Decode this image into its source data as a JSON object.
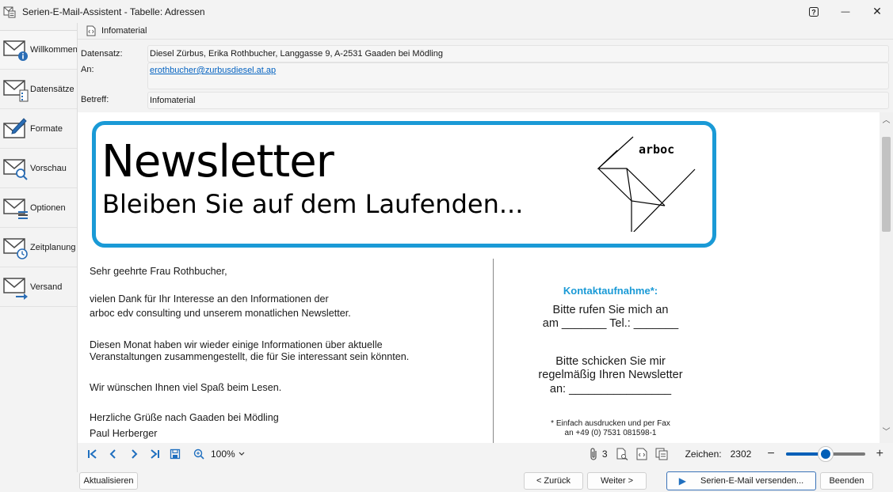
{
  "window": {
    "title": "Serien-E-Mail-Assistent - Tabelle: Adressen",
    "help_label": "?",
    "minimize_label": "—",
    "close_label": "✕"
  },
  "sidebar": {
    "items": [
      {
        "label": "Willkommen",
        "icon": "envelope-info-icon"
      },
      {
        "label": "Datensätze",
        "icon": "envelope-records-icon"
      },
      {
        "label": "Formate",
        "icon": "envelope-edit-icon"
      },
      {
        "label": "Vorschau",
        "icon": "envelope-search-icon"
      },
      {
        "label": "Optionen",
        "icon": "envelope-options-icon"
      },
      {
        "label": "Zeitplanung",
        "icon": "envelope-clock-icon"
      },
      {
        "label": "Versand",
        "icon": "envelope-send-icon"
      }
    ]
  },
  "tab": {
    "label": "Infomaterial"
  },
  "fields": {
    "record_label": "Datensatz:",
    "record_value": "Diesel Zürbus,  Erika Rothbucher,  Langgasse 9,  A-2531 Gaaden bei Mödling",
    "to_label": "An:",
    "to_value": "erothbucher@zurbusdiesel.at.ap",
    "subject_label": "Betreff:",
    "subject_value": "Infomaterial"
  },
  "preview": {
    "banner_title": "Newsletter",
    "banner_subtitle": "Bleiben Sie auf dem Laufenden...",
    "logo_text": "arboc",
    "letter": {
      "salutation": "Sehr geehrte Frau Rothbucher,",
      "para1_line1": "vielen Dank für Ihr Interesse an den Informationen der",
      "para1_line2": "arboc edv consulting und unserem monatlichen Newsletter.",
      "para2_line1": "Diesen Monat haben wir wieder einige Informationen über aktuelle",
      "para2_line2": "Veranstaltungen zusammengestellt, die für Sie interessant sein könnten.",
      "para3": "Wir wünschen Ihnen viel Spaß beim Lesen.",
      "closing": "Herzliche Grüße nach Gaaden bei Mödling",
      "signature": "Paul Herberger"
    },
    "contact": {
      "heading": "Kontaktaufnahme*:",
      "line1": "Bitte rufen Sie mich an",
      "line2": "am _______ Tel.: _______",
      "line3": "Bitte schicken Sie mir",
      "line4": "regelmäßig Ihren Newsletter",
      "line5": "an: ________________",
      "note1": "* Einfach ausdrucken und  per Fax",
      "note2": "an +49 (0) 7531 081598-1"
    }
  },
  "toolbar": {
    "zoom_label": "100%",
    "attachments_count": "3",
    "chars_label": "Zeichen:",
    "chars_value": "2302",
    "zoom_level": 0.5
  },
  "buttons": {
    "refresh": "Aktualisieren",
    "back": "< Zurück",
    "next": "Weiter >",
    "send": "Serien-E-Mail versenden...",
    "finish": "Beenden"
  },
  "colors": {
    "accent": "#1a9ad6",
    "link": "#0563c1",
    "nav_blue": "#1f6fbf"
  }
}
